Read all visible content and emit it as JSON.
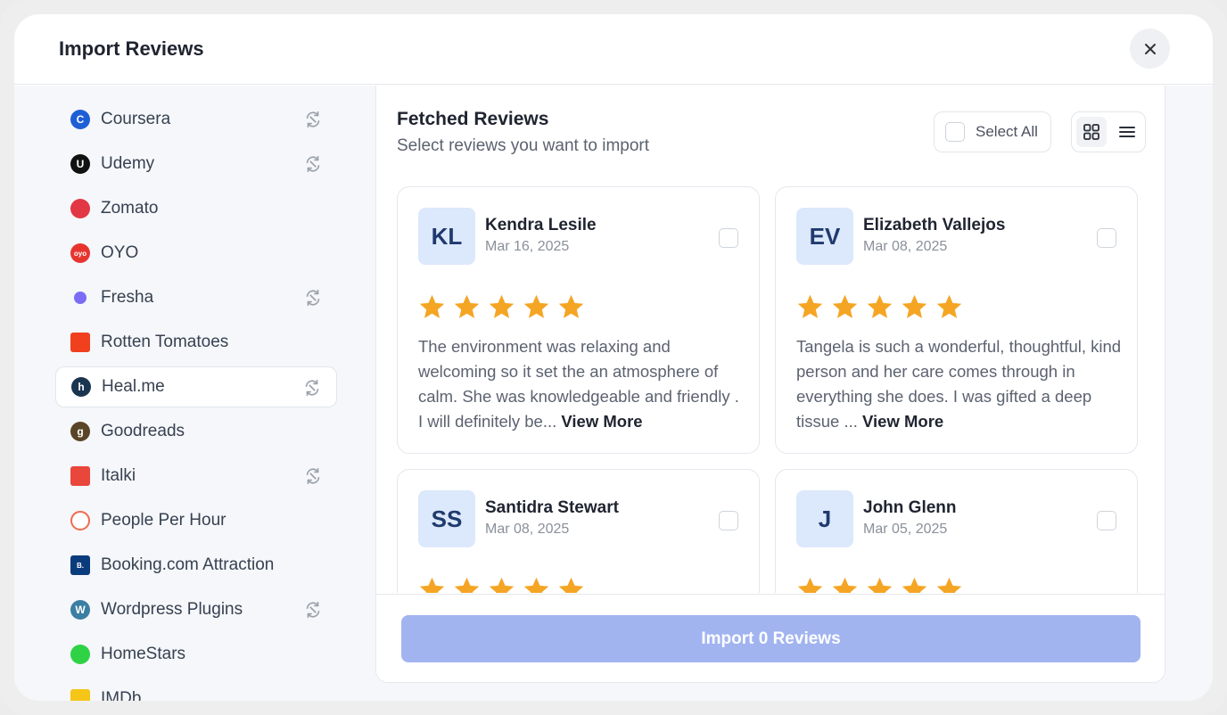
{
  "modal": {
    "title": "Import Reviews",
    "close_icon": "close-icon"
  },
  "sidebar": {
    "items": [
      {
        "label": "Coursera",
        "icon": "coursera-icon",
        "color": "#1f5fd6",
        "glyph": "C",
        "sync": true
      },
      {
        "label": "Udemy",
        "icon": "udemy-icon",
        "color": "#111111",
        "glyph": "U",
        "sync": true
      },
      {
        "label": "Zomato",
        "icon": "zomato-icon",
        "color": "#e23744",
        "glyph": "",
        "sync": false
      },
      {
        "label": "OYO",
        "icon": "oyo-icon",
        "color": "#e8342f",
        "glyph": "oyo",
        "sync": false
      },
      {
        "label": "Fresha",
        "icon": "fresha-icon",
        "color": "#7b6cf6",
        "glyph": "",
        "sync": true
      },
      {
        "label": "Rotten Tomatoes",
        "icon": "rotten-tomatoes-icon",
        "color": "#f0401e",
        "glyph": "",
        "sync": false
      },
      {
        "label": "Heal.me",
        "icon": "healme-icon",
        "color": "#1a3550",
        "glyph": "h",
        "sync": true,
        "active": true
      },
      {
        "label": "Goodreads",
        "icon": "goodreads-icon",
        "color": "#5a4526",
        "glyph": "g",
        "sync": false
      },
      {
        "label": "Italki",
        "icon": "italki-icon",
        "color": "#e9463c",
        "glyph": "",
        "sync": true
      },
      {
        "label": "People Per Hour",
        "icon": "people-per-hour-icon",
        "color": "#f06a4e",
        "glyph": "",
        "sync": false
      },
      {
        "label": "Booking.com Attraction",
        "icon": "booking-icon",
        "color": "#0a3b7c",
        "glyph": "B.",
        "sync": false
      },
      {
        "label": "Wordpress Plugins",
        "icon": "wordpress-icon",
        "color": "#3b7ea3",
        "glyph": "W",
        "sync": true
      },
      {
        "label": "HomeStars",
        "icon": "homestars-icon",
        "color": "#2fd245",
        "glyph": "",
        "sync": false
      },
      {
        "label": "IMDb",
        "icon": "imdb-icon",
        "color": "#f5c518",
        "glyph": "",
        "sync": false
      }
    ]
  },
  "main": {
    "title": "Fetched Reviews",
    "subtitle": "Select reviews you want to import",
    "select_all_label": "Select All",
    "view_toggle": {
      "grid_icon": "grid-view-icon",
      "list_icon": "list-view-icon",
      "active": "grid"
    },
    "reviews": [
      {
        "initials": "KL",
        "name": "Kendra Lesile",
        "date": "Mar 16, 2025",
        "rating": 5,
        "text": "The environment was relaxing and welcoming so it set the an atmosphere of calm. She was knowledgeable and friendly . I will definitely be...",
        "more": "View More"
      },
      {
        "initials": "EV",
        "name": "Elizabeth Vallejos",
        "date": "Mar 08, 2025",
        "rating": 5,
        "text": "Tangela is such a wonderful, thoughtful, kind person and her care comes through in everything she does. I was gifted a deep tissue ...",
        "more": "View More"
      },
      {
        "initials": "SS",
        "name": "Santidra Stewart",
        "date": "Mar 08, 2025",
        "rating": 5,
        "text": "",
        "more": ""
      },
      {
        "initials": "J",
        "name": "John Glenn",
        "date": "Mar 05, 2025",
        "rating": 5,
        "text": "",
        "more": ""
      }
    ],
    "import_button": "Import 0 Reviews"
  },
  "colors": {
    "star": "#f5a524",
    "import_button": "#a1b4f0",
    "avatar_bg": "#dce8fb"
  }
}
